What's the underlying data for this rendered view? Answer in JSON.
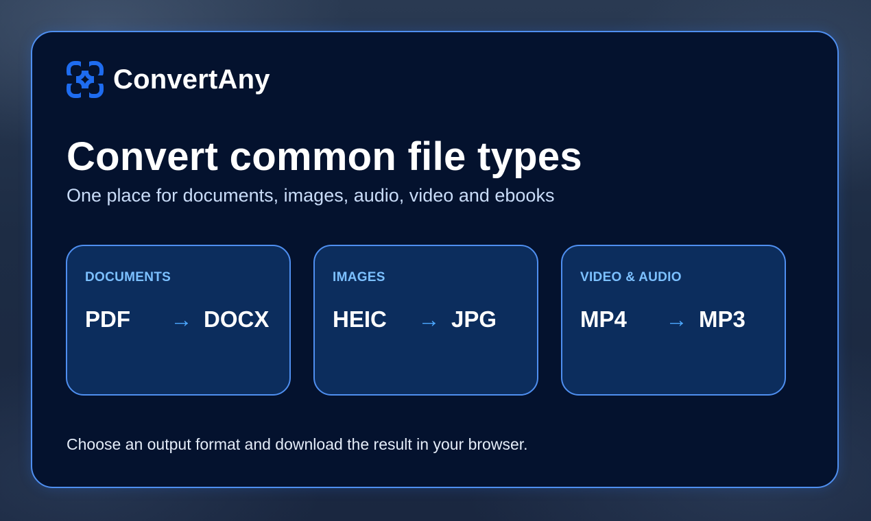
{
  "brand": {
    "name": "ConvertAny",
    "logo_icon": "converter-logo-icon",
    "accent_color": "#1e6cf0"
  },
  "hero": {
    "title": "Convert common file types",
    "subtitle": "One place for documents, images, audio, video and ebooks"
  },
  "tiles": [
    {
      "label": "DOCUMENTS",
      "from": "PDF",
      "arrow": "→",
      "to": "DOCX"
    },
    {
      "label": "IMAGES",
      "from": "HEIC",
      "arrow": "→",
      "to": "JPG"
    },
    {
      "label": "VIDEO & AUDIO",
      "from": "MP4",
      "arrow": "→",
      "to": "MP3"
    }
  ],
  "footer": {
    "text": "Choose an output format and download the result in your browser."
  },
  "colors": {
    "card_background": "#04122e",
    "card_border": "#4f8ff0",
    "tile_background": "#0c2d5d",
    "tile_label": "#7cc0ff",
    "arrow": "#4da8ff"
  }
}
